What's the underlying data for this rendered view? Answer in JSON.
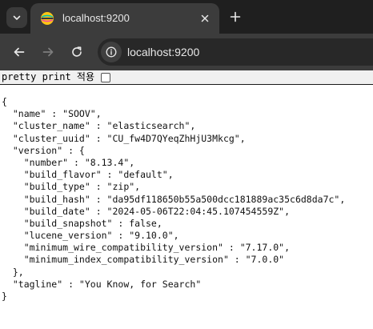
{
  "browser": {
    "tab": {
      "title": "localhost:9200"
    },
    "omnibox": {
      "url": "localhost:9200"
    },
    "icons": {
      "tab_search": "chevron-down-icon",
      "favicon": "elasticsearch-icon",
      "close": "close-icon",
      "new_tab": "plus-icon",
      "back": "arrow-left-icon",
      "forward": "arrow-right-icon",
      "reload": "reload-icon",
      "site_info": "info-icon"
    },
    "colors": {
      "tabstrip": "#1f1f1f",
      "active_tab": "#3c3c3c",
      "toolbar": "#3c3c3c",
      "omnibox": "#282828",
      "page": "#ffffff"
    }
  },
  "pretty_print": {
    "label": "pretty print 적용",
    "checked": false
  },
  "json_lines": [
    "{",
    "  \"name\" : \"SOOV\",",
    "  \"cluster_name\" : \"elasticsearch\",",
    "  \"cluster_uuid\" : \"CU_fw4D7QYeqZhHjU3Mkcg\",",
    "  \"version\" : {",
    "    \"number\" : \"8.13.4\",",
    "    \"build_flavor\" : \"default\",",
    "    \"build_type\" : \"zip\",",
    "    \"build_hash\" : \"da95df118650b55a500dcc181889ac35c6d8da7c\",",
    "    \"build_date\" : \"2024-05-06T22:04:45.107454559Z\",",
    "    \"build_snapshot\" : false,",
    "    \"lucene_version\" : \"9.10.0\",",
    "    \"minimum_wire_compatibility_version\" : \"7.17.0\",",
    "    \"minimum_index_compatibility_version\" : \"7.0.0\"",
    "  },",
    "  \"tagline\" : \"You Know, for Search\"",
    "}"
  ]
}
